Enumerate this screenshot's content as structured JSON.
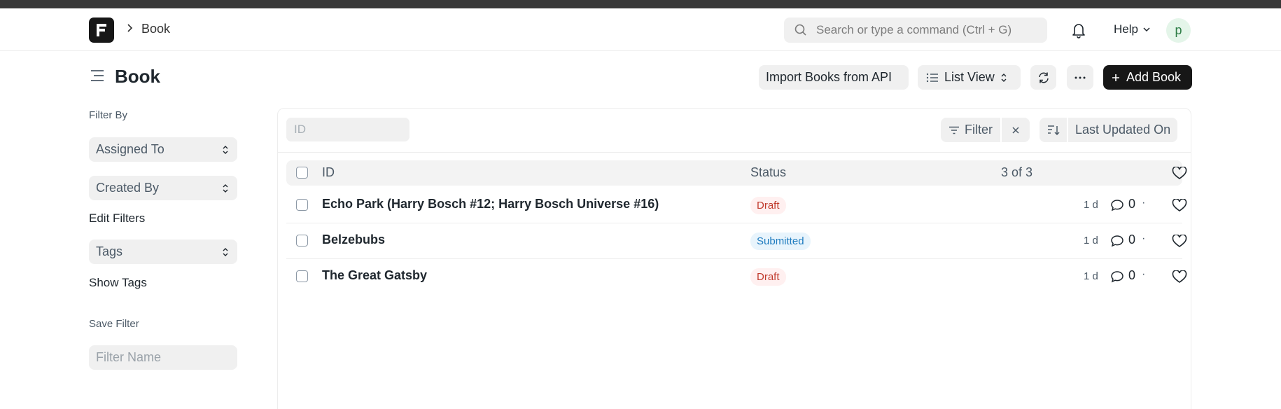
{
  "navbar": {
    "breadcrumb": "Book",
    "search_placeholder": "Search or type a command (Ctrl + G)",
    "help_label": "Help",
    "avatar_initial": "p"
  },
  "page": {
    "title": "Book",
    "import_label": "Import Books from API",
    "view_label": "List View",
    "add_label": "Add Book"
  },
  "sidebar": {
    "filter_by_label": "Filter By",
    "assigned_to": "Assigned To",
    "created_by": "Created By",
    "edit_filters": "Edit Filters",
    "tags": "Tags",
    "show_tags": "Show Tags",
    "save_filter_label": "Save Filter",
    "filter_name_placeholder": "Filter Name"
  },
  "list": {
    "id_placeholder": "ID",
    "filter_label": "Filter",
    "sort_label": "Last Updated On",
    "columns": {
      "id": "ID",
      "status": "Status"
    },
    "count": "3 of 3",
    "rows": [
      {
        "title": "Echo Park (Harry Bosch #12; Harry Bosch Universe #16)",
        "status": "Draft",
        "age": "1 d",
        "comments": "0"
      },
      {
        "title": "Belzebubs",
        "status": "Submitted",
        "age": "1 d",
        "comments": "0"
      },
      {
        "title": "The Great Gatsby",
        "status": "Draft",
        "age": "1 d",
        "comments": "0"
      }
    ],
    "separator": "·"
  },
  "colors": {
    "brand_dark": "#171717",
    "draft_text": "#c0392b",
    "draft_bg": "#fff0f0",
    "submitted_text": "#1e7bbf",
    "submitted_bg": "#e8f4fc"
  }
}
